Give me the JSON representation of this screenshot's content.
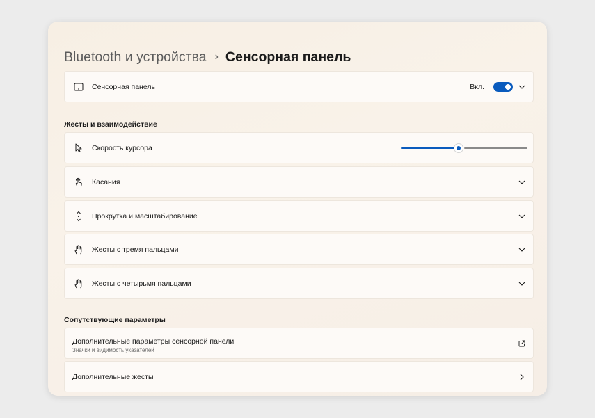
{
  "breadcrumb": {
    "parent": "Bluetooth и устройства",
    "separator": "›",
    "current": "Сенсорная панель"
  },
  "touchpad_card": {
    "icon": "touchpad-icon",
    "label": "Сенсорная панель",
    "toggle_state_text": "Вкл.",
    "toggle_on": true
  },
  "gestures_section": {
    "title": "Жесты и взаимодействие",
    "items": [
      {
        "icon": "cursor-icon",
        "label": "Скорость курсора",
        "slider_value_fraction": 0.45
      },
      {
        "icon": "tap-hand-icon",
        "label": "Касания"
      },
      {
        "icon": "scroll-icon",
        "label": "Прокрутка и масштабирование"
      },
      {
        "icon": "three-finger-hand-icon",
        "label": "Жесты с тремя пальцами"
      },
      {
        "icon": "four-finger-hand-icon",
        "label": "Жесты с четырьмя пальцами"
      }
    ]
  },
  "related_section": {
    "title": "Сопутствующие параметры",
    "items": [
      {
        "title": "Дополнительные параметры сенсорной панели",
        "subtitle": "Значки и видимость указателей",
        "icon": "open-external-icon"
      },
      {
        "title": "Дополнительные жесты",
        "icon": "chevron-right-icon"
      }
    ]
  },
  "colors": {
    "accent": "#0a5bbd",
    "card_background": "#fdfaf7",
    "window_background": "#f7efe4"
  }
}
